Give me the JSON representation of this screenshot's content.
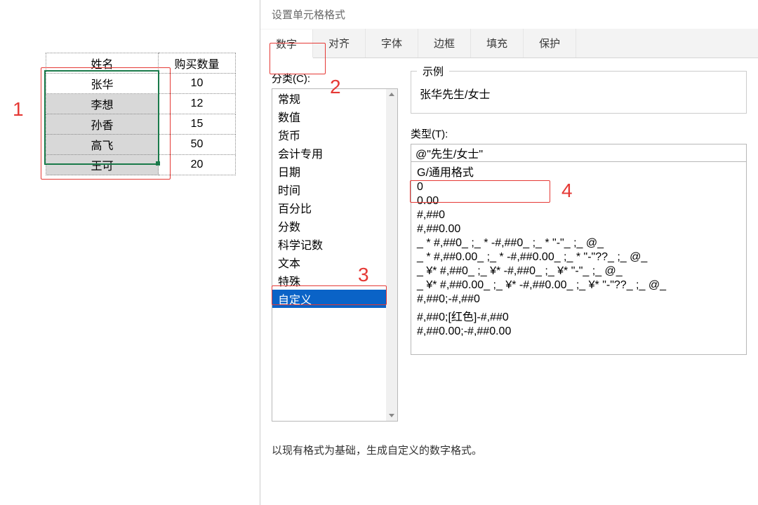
{
  "spreadsheet": {
    "headers": {
      "name": "姓名",
      "qty": "购买数量"
    },
    "rows": [
      {
        "name": "张华",
        "qty": "10"
      },
      {
        "name": "李想",
        "qty": "12"
      },
      {
        "name": "孙香",
        "qty": "15"
      },
      {
        "name": "高飞",
        "qty": "50"
      },
      {
        "name": "王可",
        "qty": "20"
      }
    ]
  },
  "annotations": {
    "a1": "1",
    "a2": "2",
    "a3": "3",
    "a4": "4"
  },
  "dialog": {
    "title": "设置单元格格式",
    "tabs": {
      "number": "数字",
      "align": "对齐",
      "font": "字体",
      "border": "边框",
      "fill": "填充",
      "protect": "保护"
    },
    "category_label": "分类(C):",
    "categories": {
      "c0": "常规",
      "c1": "数值",
      "c2": "货币",
      "c3": "会计专用",
      "c4": "日期",
      "c5": "时间",
      "c6": "百分比",
      "c7": "分数",
      "c8": "科学记数",
      "c9": "文本",
      "c10": "特殊",
      "c11": "自定义"
    },
    "sample_label": "示例",
    "sample_value": "张华先生/女士",
    "type_label": "类型(T):",
    "type_value": "@\"先生/女士\"",
    "formats": {
      "f0": "G/通用格式",
      "f1": "0",
      "f2": "0.00",
      "f3": "#,##0",
      "f4": "#,##0.00",
      "f5": "_ * #,##0_ ;_ * -#,##0_ ;_ * \"-\"_ ;_ @_",
      "f6": "_ * #,##0.00_ ;_ * -#,##0.00_ ;_ * \"-\"??_ ;_ @_",
      "f7": "_ ¥* #,##0_ ;_ ¥* -#,##0_ ;_ ¥* \"-\"_ ;_ @_",
      "f8": "_ ¥* #,##0.00_ ;_ ¥* -#,##0.00_ ;_ ¥* \"-\"??_ ;_ @_",
      "f9": "#,##0;-#,##0",
      "f10": "#,##0;[红色]-#,##0",
      "f11": "#,##0.00;-#,##0.00"
    },
    "hint": "以现有格式为基础，生成自定义的数字格式。"
  }
}
